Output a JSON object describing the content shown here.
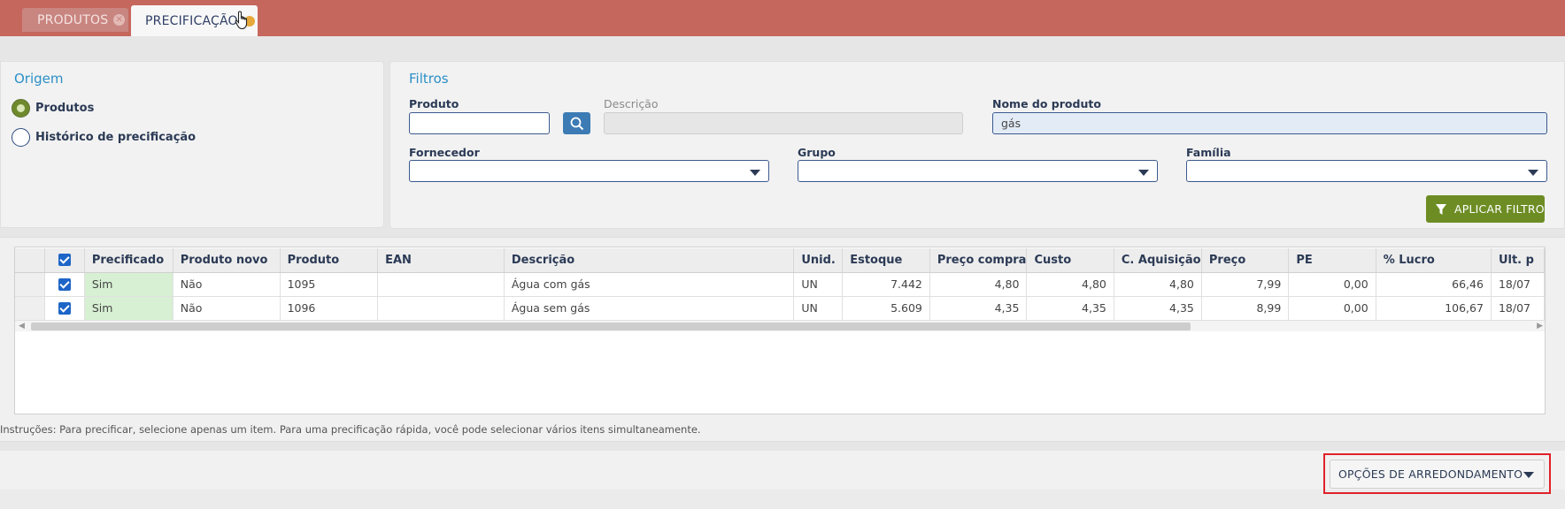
{
  "tabs": [
    {
      "label": "PRODUTOS",
      "active": false
    },
    {
      "label": "PRECIFICAÇÃO",
      "active": true
    }
  ],
  "origem": {
    "title": "Origem",
    "options": [
      {
        "label": "Produtos",
        "selected": true
      },
      {
        "label": "Histórico de precificação",
        "selected": false
      }
    ]
  },
  "filtros": {
    "title": "Filtros",
    "produto": {
      "label": "Produto",
      "value": ""
    },
    "descricao": {
      "label": "Descrição",
      "value": ""
    },
    "nome_produto": {
      "label": "Nome do produto",
      "value": "gás"
    },
    "fornecedor": {
      "label": "Fornecedor",
      "value": ""
    },
    "grupo": {
      "label": "Grupo",
      "value": ""
    },
    "familia": {
      "label": "Família",
      "value": ""
    },
    "apply_label": "APLICAR FILTRO"
  },
  "grid": {
    "columns": [
      "Precificado",
      "Produto novo",
      "Produto",
      "EAN",
      "Descrição",
      "Unid.",
      "Estoque",
      "Preço compra",
      "Custo",
      "C. Aquisição",
      "Preço",
      "PE",
      "% Lucro",
      "Ult. p"
    ],
    "rows": [
      {
        "checked": true,
        "cells": [
          "Sim",
          "Não",
          "1095",
          "",
          "Água com gás",
          "UN",
          "7.442",
          "4,80",
          "4,80",
          "4,80",
          "7,99",
          "0,00",
          "66,46",
          "18/07"
        ]
      },
      {
        "checked": true,
        "cells": [
          "Sim",
          "Não",
          "1096",
          "",
          "Água sem gás",
          "UN",
          "5.609",
          "4,35",
          "4,35",
          "4,35",
          "8,99",
          "0,00",
          "106,67",
          "18/07"
        ]
      }
    ]
  },
  "instructions": "Instruções: Para precificar, selecione apenas um item. Para uma precificação rápida, você pode selecionar vários itens simultaneamente.",
  "rounding_button": "OPÇÕES DE ARREDONDAMENTO",
  "colors": {
    "header": "#c6675d",
    "accent": "#2b8fc7",
    "apply": "#6d8d24",
    "highlight": "#e0202a"
  }
}
